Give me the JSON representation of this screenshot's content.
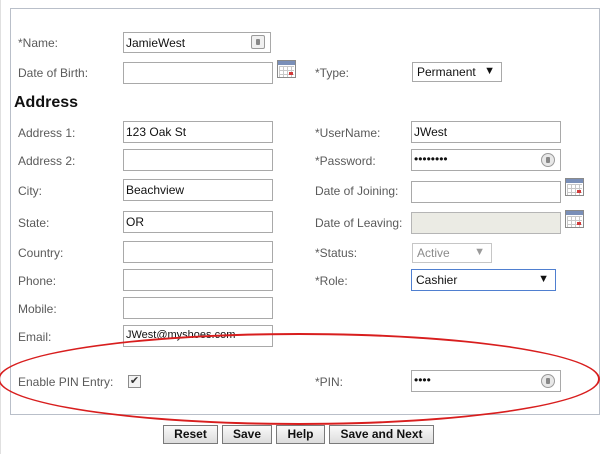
{
  "form": {
    "name_label": "*Name:",
    "name_value": "JamieWest",
    "dob_label": "Date of Birth:",
    "dob_value": "",
    "type_label": "*Type:",
    "type_value": "Permanent",
    "address_heading": "Address",
    "address1_label": "Address 1:",
    "address1_value": "123 Oak St",
    "address2_label": "Address 2:",
    "address2_value": "",
    "city_label": "City:",
    "city_value": "Beachview",
    "state_label": "State:",
    "state_value": "OR",
    "country_label": "Country:",
    "country_value": "",
    "phone_label": "Phone:",
    "phone_value": "",
    "mobile_label": "Mobile:",
    "mobile_value": "",
    "email_label": "Email:",
    "email_value": "JWest@myshoes.com",
    "username_label": "*UserName:",
    "username_value": "JWest",
    "password_label": "*Password:",
    "password_value": "••••••••",
    "doj_label": "Date of Joining:",
    "doj_value": "",
    "dol_label": "Date of Leaving:",
    "dol_value": "",
    "status_label": "*Status:",
    "status_value": "Active",
    "role_label": "*Role:",
    "role_value": "Cashier",
    "pin_entry_label": "Enable PIN Entry:",
    "pin_entry_checked": true,
    "pin_label": "*PIN:",
    "pin_value": "••••"
  },
  "buttons": {
    "reset": "Reset",
    "save": "Save",
    "help": "Help",
    "save_next": "Save and Next"
  },
  "icons": {
    "calendar": "calendar-icon",
    "contact": "contact-card-icon",
    "password_reveal": "password-reveal-icon",
    "dropdown": "▼",
    "checkmark": "✔"
  },
  "colors": {
    "annotation": "#d81e1e",
    "disabled_field": "#ebebe4",
    "focus_border": "#4f7fd0"
  }
}
